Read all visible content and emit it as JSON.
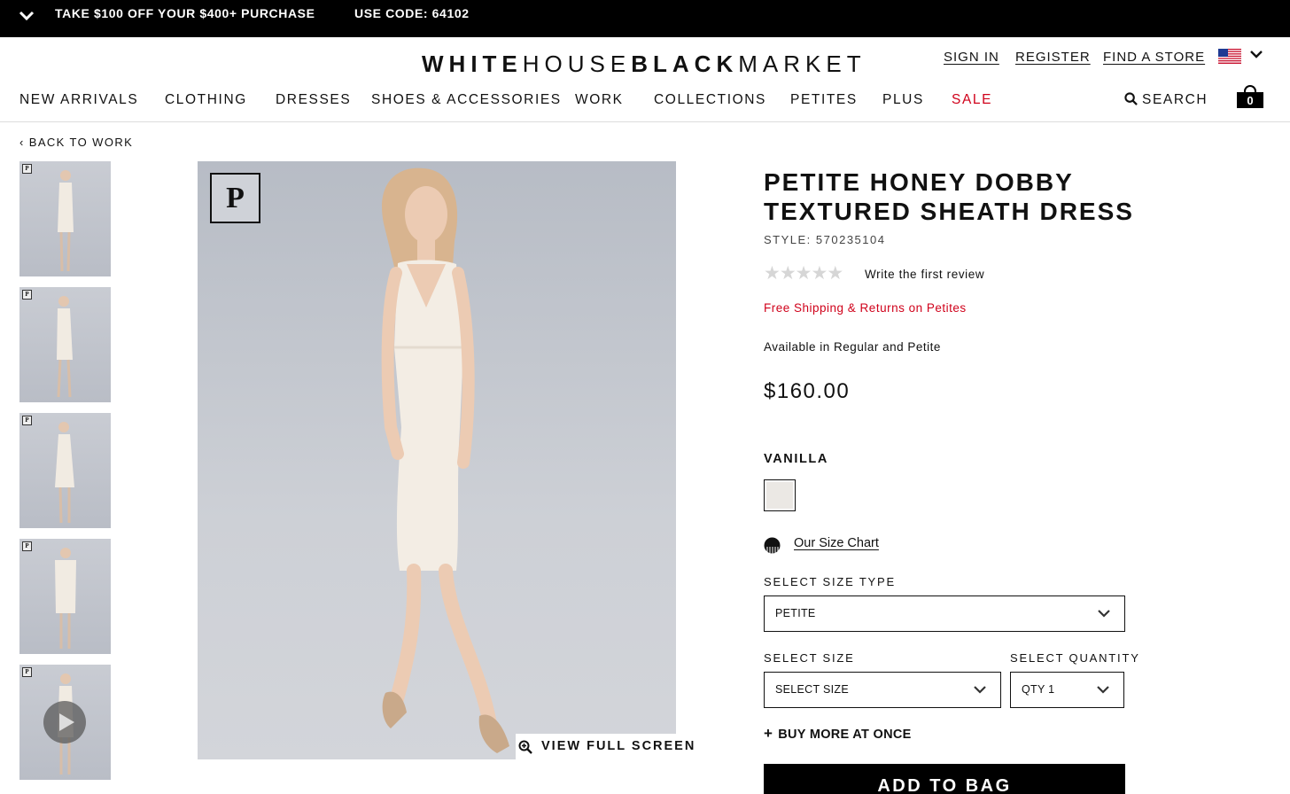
{
  "promo": {
    "offer": "TAKE $100 OFF YOUR $400+ PURCHASE",
    "code": "USE CODE: 64102",
    "toggle_icon": "chevron-down-icon"
  },
  "header": {
    "logo_white_house": "WHITE",
    "logo_house": "HOUSE",
    "logo_black": "BLACK",
    "logo_market": "MARKET",
    "sign_in": "SIGN IN",
    "register": "REGISTER",
    "find_store": "FIND A STORE",
    "country_icon": "us-flag-icon"
  },
  "nav": {
    "items": [
      "NEW ARRIVALS",
      "CLOTHING",
      "DRESSES",
      "SHOES & ACCESSORIES",
      "WORK",
      "COLLECTIONS",
      "PETITES",
      "PLUS",
      "SALE"
    ],
    "search": "SEARCH",
    "bag_count": "0"
  },
  "breadcrumb": {
    "back": "BACK TO WORK"
  },
  "gallery": {
    "badge": "P",
    "view_full_screen": "VIEW FULL SCREEN",
    "thumbnail_count": 5
  },
  "product": {
    "title_line1": "PETITE HONEY DOBBY",
    "title_line2": "TEXTURED SHEATH DRESS",
    "style": "STYLE: 570235104",
    "rating": 0,
    "review_link": "Write the first review",
    "shipping": "Free Shipping & Returns on Petites",
    "availability": "Available in Regular and Petite",
    "price": "$160.00",
    "color": "VANILLA",
    "swatch_color": "#ebe8e4",
    "size_chart": "Our Size Chart",
    "size_type_label": "SELECT SIZE TYPE",
    "size_type_value": "PETITE",
    "size_label": "SELECT SIZE",
    "size_value": "SELECT SIZE",
    "qty_label": "SELECT QUANTITY",
    "qty_value": "QTY 1",
    "buy_more": "BUY MORE AT ONCE",
    "add_to_bag": "ADD TO BAG"
  },
  "colors": {
    "accent_red": "#d0021b",
    "promo_bg": "#000000"
  }
}
